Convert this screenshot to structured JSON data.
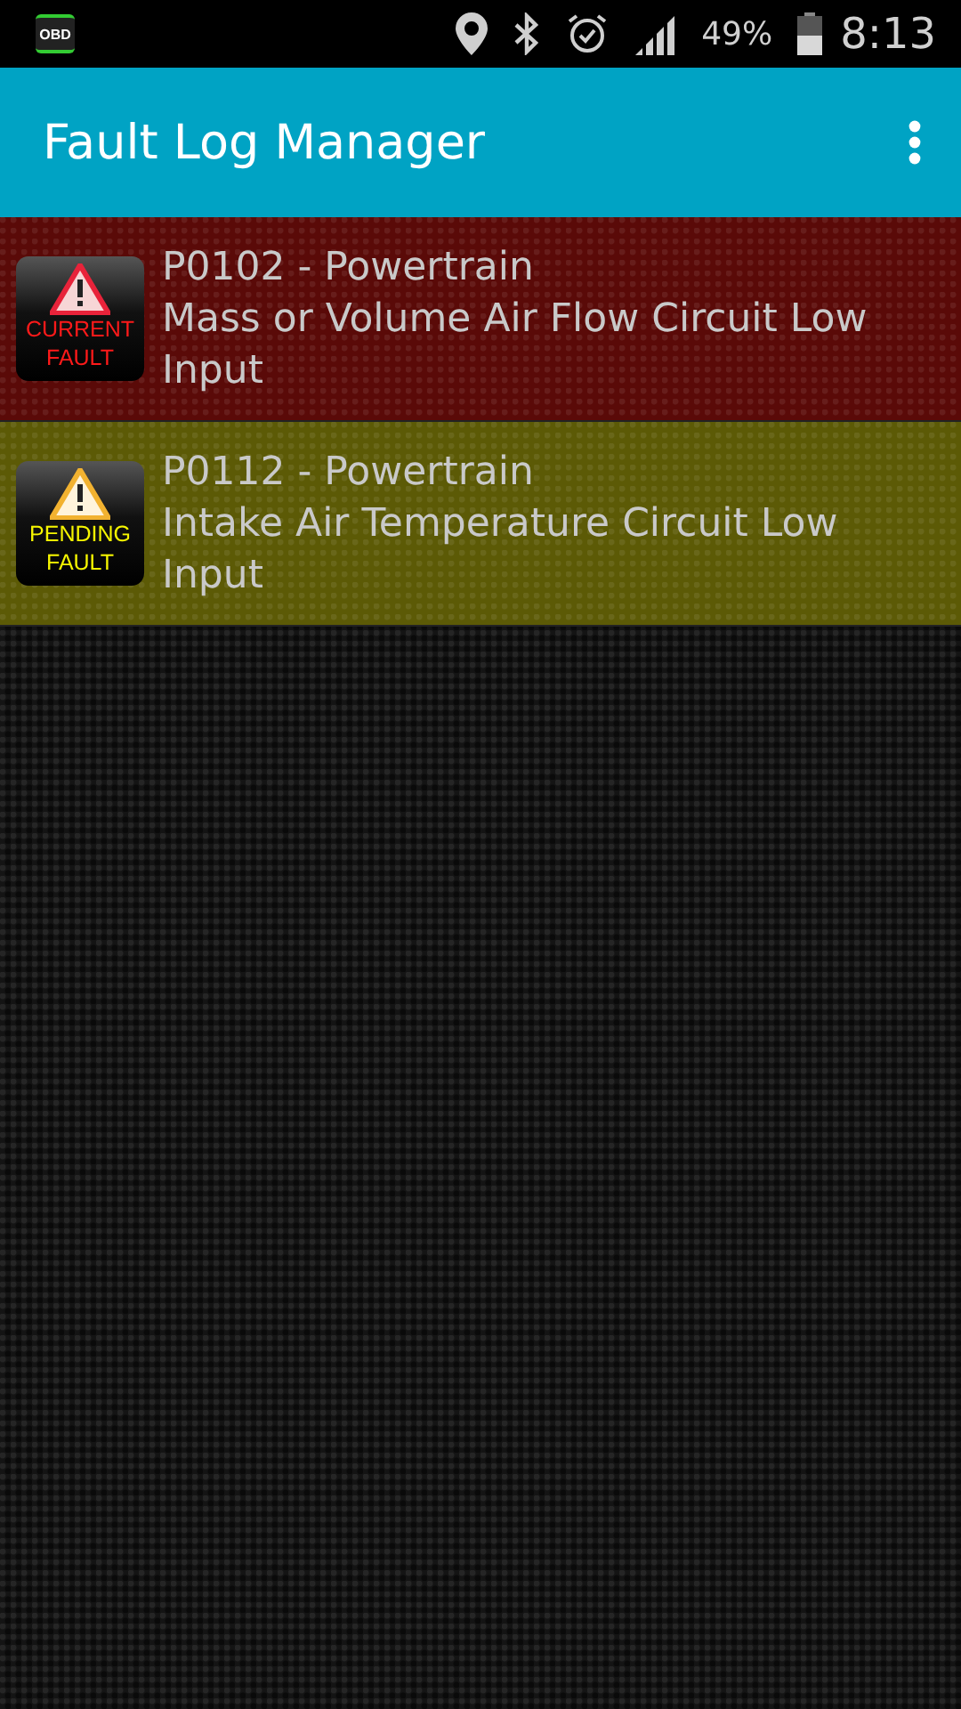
{
  "status_bar": {
    "app_badge": "OBD",
    "battery": "49%",
    "time": "8:13"
  },
  "app_bar": {
    "title": "Fault Log Manager"
  },
  "faults": [
    {
      "kind": "current",
      "badge_lines": [
        "CURRENT",
        "FAULT"
      ],
      "code": "P0102 - Powertrain",
      "description": "Mass or Volume Air Flow Circuit Low Input"
    },
    {
      "kind": "pending",
      "badge_lines": [
        "PENDING",
        "FAULT"
      ],
      "code": "P0112 - Powertrain",
      "description": "Intake Air Temperature Circuit Low Input"
    }
  ]
}
